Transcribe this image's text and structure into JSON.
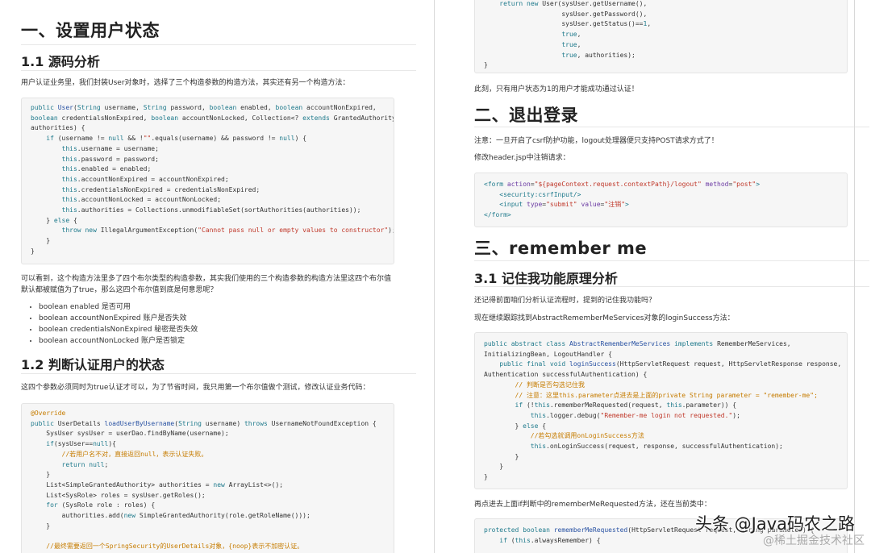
{
  "left": {
    "h1": "一、设置用户状态",
    "h2a": "1.1 源码分析",
    "p1": "用户认证业务里，我们封装User对象时，选择了三个构造参数的构造方法，其实还有另一个构造方法：",
    "p2": "可以看到，这个构造方法里多了四个布尔类型的构造参数，其实我们使用的三个构造参数的构造方法里这四个布尔值默认都被赋值为了true，那么这四个布尔值到底是何意思呢？",
    "bullets": [
      "boolean enabled  是否可用",
      "boolean accountNonExpired 账户是否失效",
      "boolean credentialsNonExpired 秘密是否失效",
      "boolean accountNonLocked 账户是否锁定"
    ],
    "h2b": "1.2 判断认证用户的状态",
    "p3": "这四个参数必须同时为true认证才可以，为了节省时间，我只用第一个布尔值做个测试，修改认证业务代码："
  },
  "right": {
    "p1": "此刻，只有用户状态为1的用户才能成功通过认证！",
    "h1a": "二、退出登录",
    "p2": "注意：一旦开启了csrf防护功能，logout处理器便只支持POST请求方式了！",
    "p3": "修改header.jsp中注销请求：",
    "h1b": "三、remember me",
    "h2": "3.1 记住我功能原理分析",
    "p4": "还记得前面咱们分析认证流程时，提到的记住我功能吗？",
    "p5": "现在继续跟踪找到AbstractRememberMeServices对象的loginSuccess方法：",
    "p6": "再点进去上面if判断中的rememberMeRequested方法，还在当前类中："
  },
  "watermark": {
    "main": "头条 @Java码农之路",
    "sub": "@稀土掘金技术社区"
  }
}
